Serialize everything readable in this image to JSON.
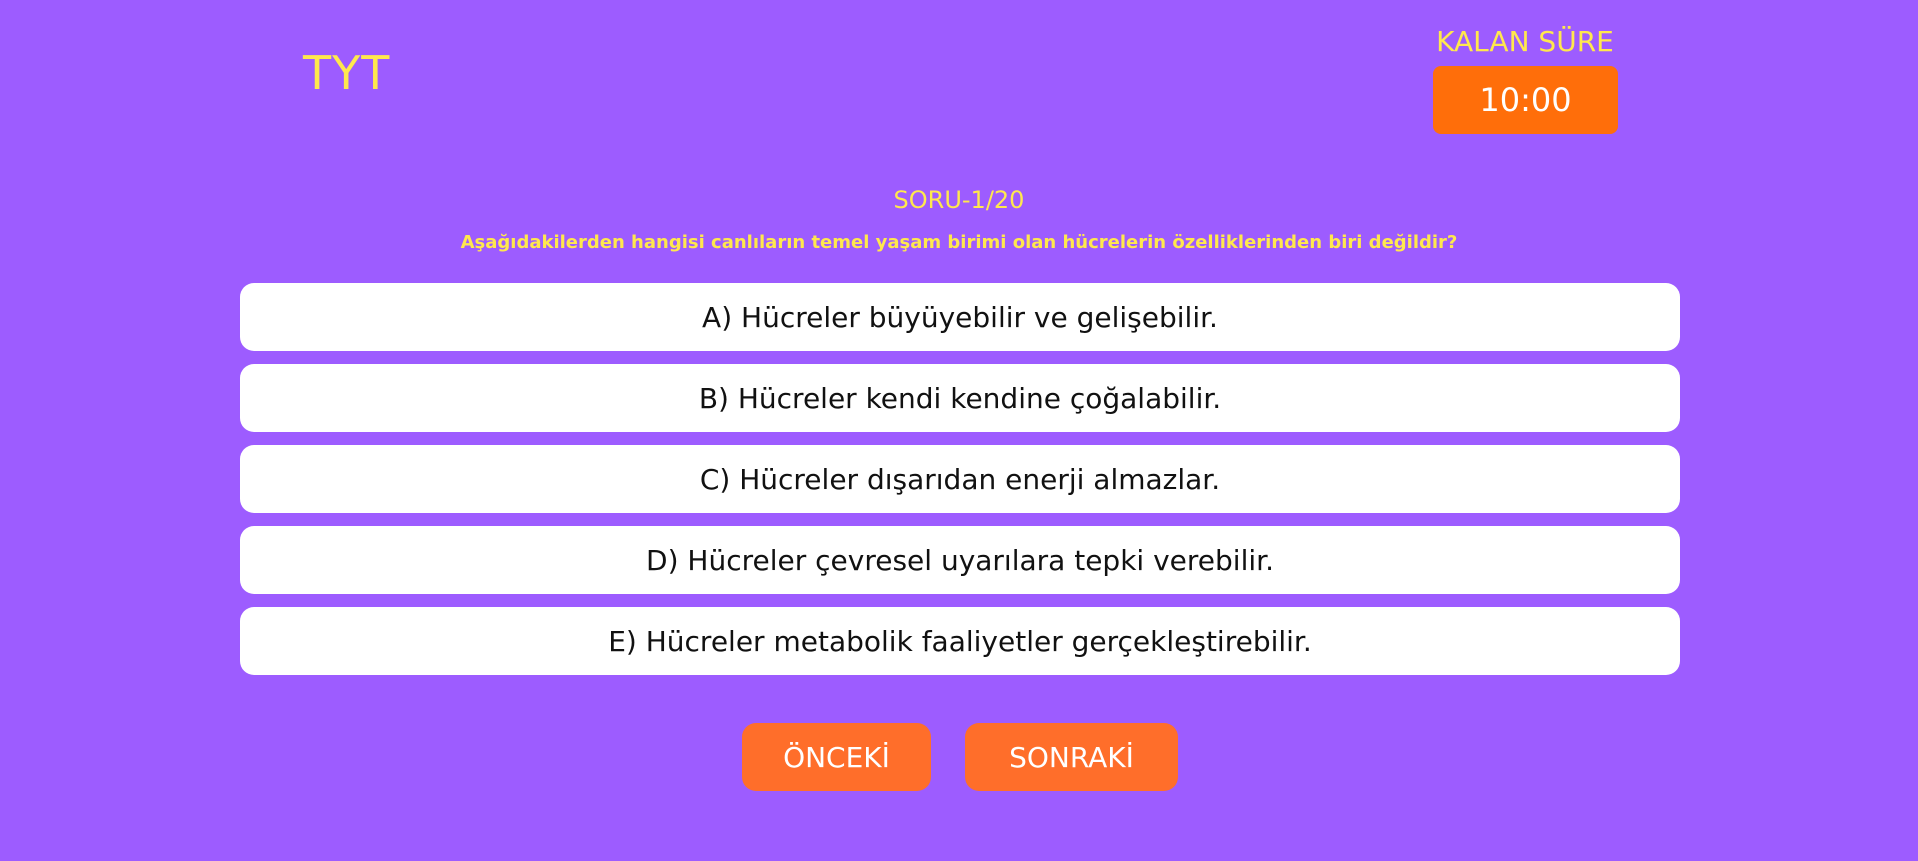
{
  "header": {
    "exam_title": "TYT",
    "timer_label": "KALAN SÜRE",
    "timer_value": "10:00"
  },
  "question": {
    "counter": "SORU-1/20",
    "text": "Aşağıdakilerden hangisi canlıların temel yaşam birimi olan hücrelerin özelliklerinden biri değildir?",
    "options": [
      "A) Hücreler büyüyebilir ve gelişebilir.",
      "B) Hücreler kendi kendine çoğalabilir.",
      "C) Hücreler dışarıdan enerji almazlar.",
      "D) Hücreler çevresel uyarılara tepki verebilir.",
      "E) Hücreler metabolik faaliyetler gerçekleştirebilir."
    ]
  },
  "navigation": {
    "prev_label": "ÖNCEKİ",
    "next_label": "SONRAKİ"
  },
  "colors": {
    "background": "#9d5cff",
    "accent_text": "#ffe84d",
    "button": "#ff6e2a",
    "option_bg": "#ffffff"
  }
}
